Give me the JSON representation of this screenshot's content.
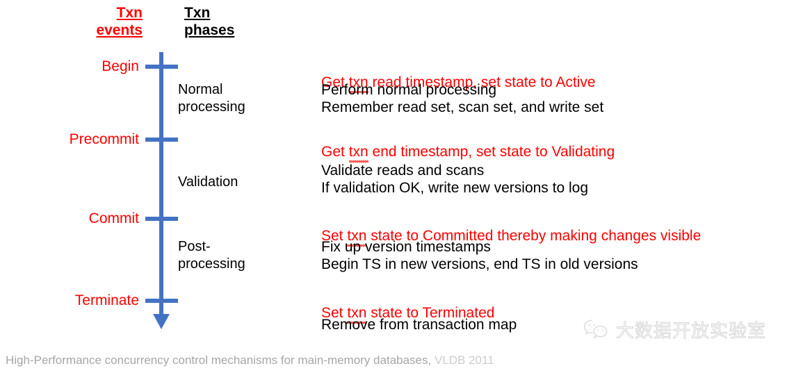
{
  "headers": {
    "events": "Txn\nevents",
    "phases": "Txn\nphases"
  },
  "colors": {
    "axis_blue": "#4472C4",
    "event_red": "#FF0000",
    "phase_black": "#000000",
    "citation_grey": "#A6A6A6",
    "venue_grey": "#CCCCCC"
  },
  "timeline": {
    "events": [
      {
        "label": "Begin"
      },
      {
        "label": "Precommit"
      },
      {
        "label": "Commit"
      },
      {
        "label": "Terminate"
      }
    ],
    "phases": [
      {
        "label": "Normal\nprocessing"
      },
      {
        "label": "Validation"
      },
      {
        "label": "Post-\nprocessing"
      }
    ]
  },
  "descriptions": {
    "begin_action": {
      "pre": "Get ",
      "word": "txn",
      "post": " read timestamp, set state to Active"
    },
    "normal_processing": "Perform normal processing\nRemember read set, scan set, and write set",
    "precommit_action": {
      "pre": "Get ",
      "word": "txn",
      "post": " end timestamp, set state to Validating"
    },
    "validation": "Validate reads and scans\nIf validation OK, write new versions to log",
    "commit_action": {
      "pre": "Set ",
      "word": "txn",
      "post": " state to Committed thereby making changes visible"
    },
    "post_processing": "Fix up version timestamps\nBegin TS in new versions, end TS in old versions",
    "terminate_action": {
      "pre": "Set ",
      "word": "txn",
      "post": " state to Terminated"
    },
    "terminate_followup": "Remove from transaction map"
  },
  "citation": {
    "title": "High-Performance concurrency control mechanisms for main-memory databases,",
    "venue": "VLDB 2011"
  },
  "watermark": {
    "icon": "wechat-icon",
    "text": "大数据开放实验室"
  }
}
